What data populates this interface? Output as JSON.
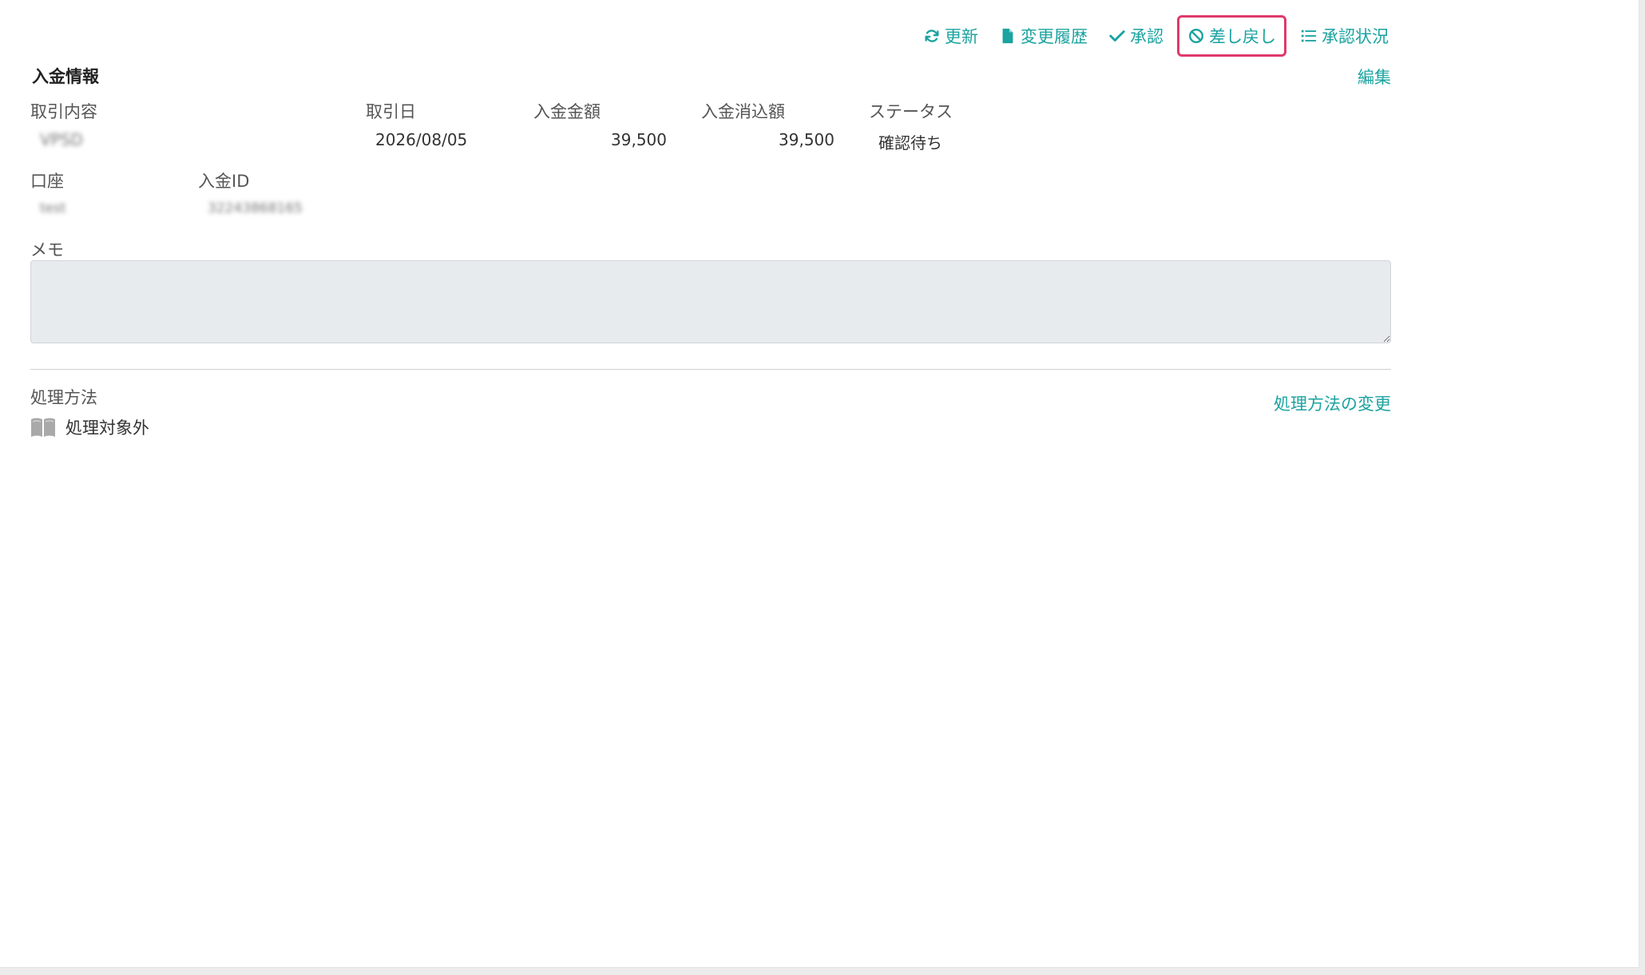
{
  "toolbar": {
    "refresh_label": "更新",
    "history_label": "変更履歴",
    "approve_label": "承認",
    "sendback_label": "差し戻し",
    "status_label": "承認状況"
  },
  "section": {
    "title": "入金情報",
    "edit_label": "編集"
  },
  "fields": {
    "transaction_label": "取引内容",
    "transaction_value": "VPSD",
    "date_label": "取引日",
    "date_value": "2026/08/05",
    "amount_label": "入金金額",
    "amount_value": "39,500",
    "cleared_label": "入金消込額",
    "cleared_value": "39,500",
    "status_label": "ステータス",
    "status_value": "確認待ち",
    "account_label": "口座",
    "account_value": "test",
    "deposit_id_label": "入金ID",
    "deposit_id_value": "32243868165"
  },
  "memo": {
    "label": "メモ",
    "value": ""
  },
  "processing": {
    "label": "処理方法",
    "change_label": "処理方法の変更",
    "method_value": "処理対象外",
    "method_icon": "book-icon"
  },
  "colors": {
    "accent": "#1ba3a0",
    "highlight": "#e0396b"
  }
}
